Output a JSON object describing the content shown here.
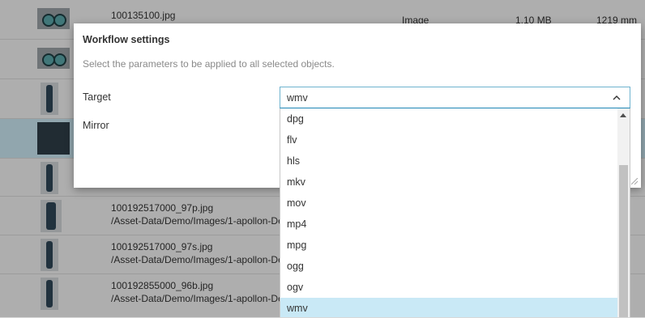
{
  "table": {
    "rows": [
      {
        "name": "100135100.jpg",
        "path": "",
        "type": "Image",
        "size": "1.10 MB",
        "dim": "1219 mm",
        "thumb": "wide"
      },
      {
        "name": "",
        "path": "",
        "type": "",
        "size": "",
        "dim": "",
        "thumb": "wide"
      },
      {
        "name": "",
        "path": "",
        "type": "",
        "size": "",
        "dim": "",
        "thumb": "person"
      },
      {
        "name": "",
        "path": "",
        "type": "",
        "size": "",
        "dim": "",
        "thumb": "fabric",
        "selected": true
      },
      {
        "name": "",
        "path": "",
        "type": "",
        "size": "",
        "dim": "",
        "thumb": "person"
      },
      {
        "name": "100192517000_97p.jpg",
        "path": "/Asset-Data/Demo/Images/1-apollon-De",
        "type": "",
        "size": "",
        "dim": "",
        "thumb": "person"
      },
      {
        "name": "100192517000_97s.jpg",
        "path": "/Asset-Data/Demo/Images/1-apollon-De",
        "type": "",
        "size": "",
        "dim": "",
        "thumb": "person"
      },
      {
        "name": "100192855000_96b.jpg",
        "path": "/Asset-Data/Demo/Images/1-apollon-De",
        "type": "",
        "size": "",
        "dim": "",
        "thumb": "person"
      }
    ]
  },
  "dialog": {
    "title": "Workflow settings",
    "description": "Select the parameters to be applied to all selected objects.",
    "target_label": "Target",
    "mirror_label": "Mirror",
    "target_value": "wmv"
  },
  "dropdown": {
    "options": [
      "dpg",
      "flv",
      "hls",
      "mkv",
      "mov",
      "mp4",
      "mpg",
      "ogg",
      "ogv",
      "wmv"
    ],
    "selected": "wmv"
  },
  "icons": {
    "select_chevron": "chevron-up-icon",
    "scroll_up": "scroll-up-arrow-icon",
    "resize": "resize-grip-icon"
  },
  "colors": {
    "accent": "#1d86b5",
    "selected_option": "#c9e9f6",
    "selected_row": "#c9e6f1"
  }
}
